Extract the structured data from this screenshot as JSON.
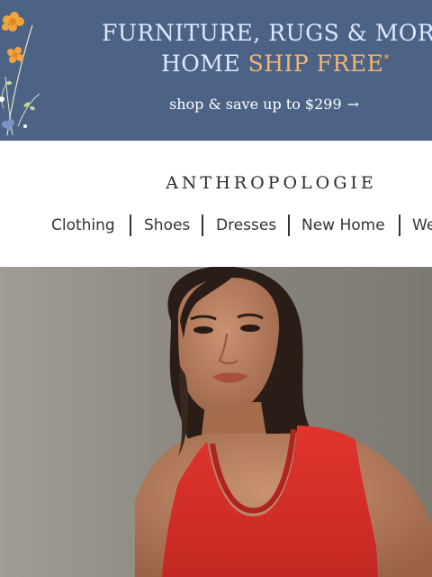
{
  "banner": {
    "line1": "FURNITURE, RUGS & MORE",
    "line2_home": "HOME",
    "line2_ship_free": "SHIP FREE",
    "asterisk": "*",
    "shop_text": "shop & save up to $299",
    "shop_arrow": "→",
    "colors": {
      "background": "#4b6285",
      "headline": "#dfe8ff",
      "accent": "#f4b471"
    }
  },
  "header": {
    "logo": "ANTHROPOLOGIE",
    "nav": [
      {
        "label": "Clothing"
      },
      {
        "label": "Shoes"
      },
      {
        "label": "Dresses"
      },
      {
        "label": "New Home"
      },
      {
        "label": "We"
      }
    ]
  },
  "hero": {
    "icon": "model-photo",
    "colors": {
      "backdrop": "#8a867f",
      "top": "#d8302c"
    }
  }
}
